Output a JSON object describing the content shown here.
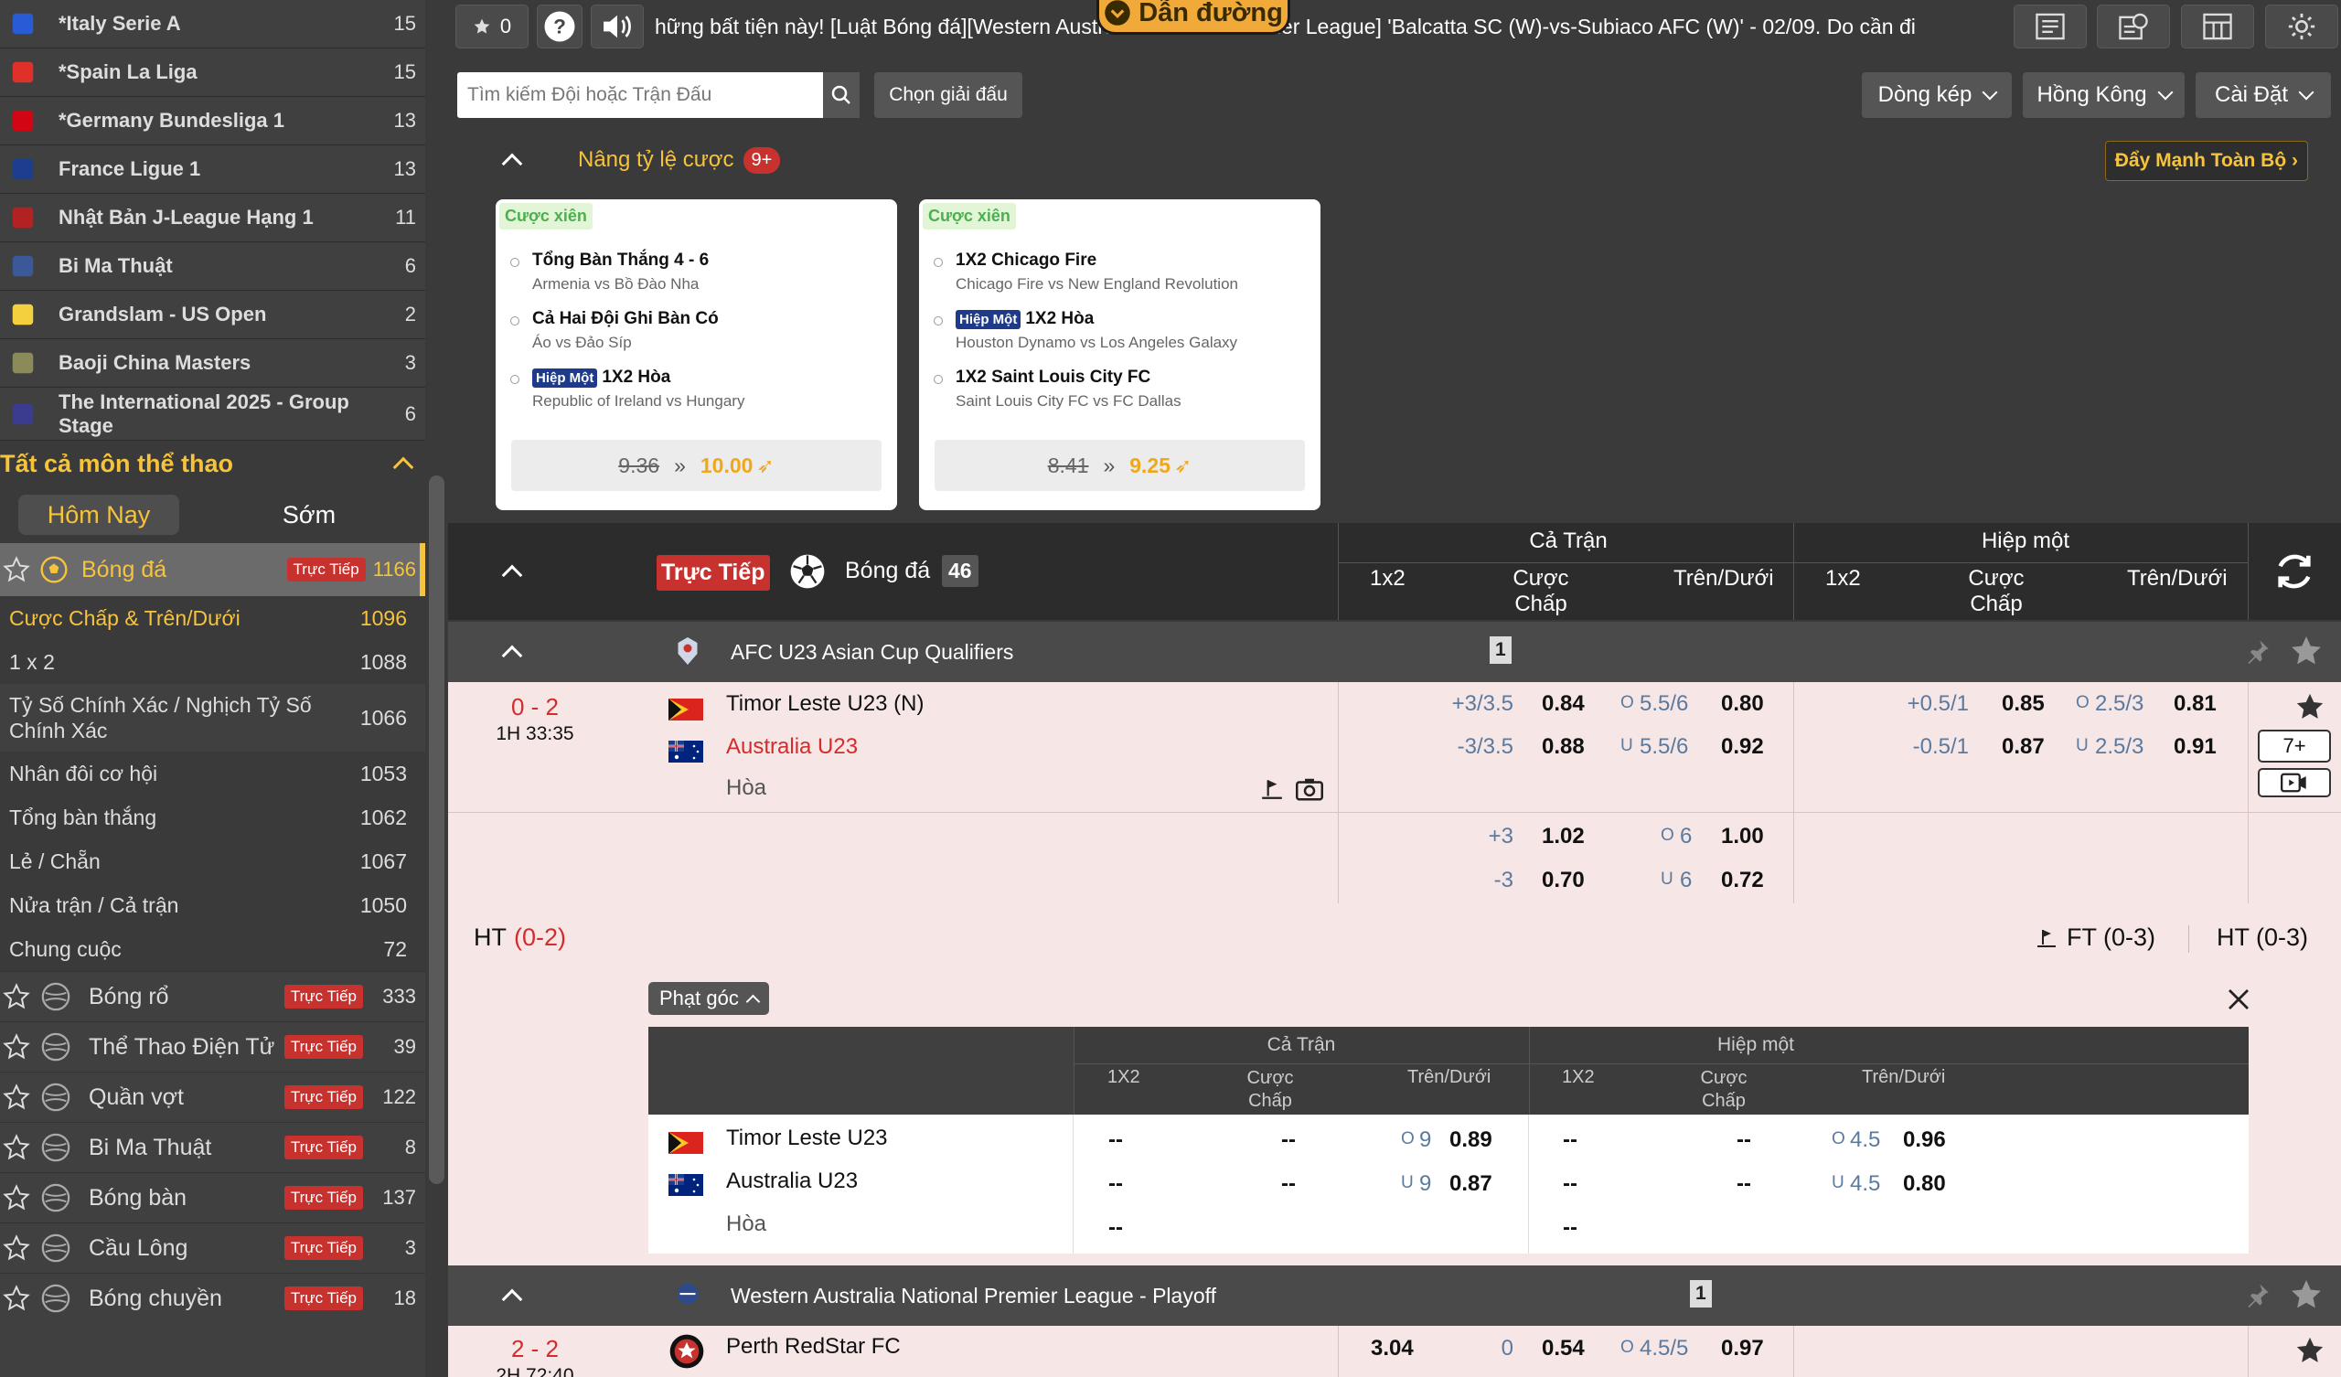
{
  "left_leagues": [
    {
      "name": "*Italy Serie A",
      "count": "15",
      "icon": "serie-a-icon",
      "color": "#2a5bd7"
    },
    {
      "name": "*Spain La Liga",
      "count": "15",
      "icon": "laliga-icon",
      "color": "#e0302a"
    },
    {
      "name": "*Germany Bundesliga 1",
      "count": "13",
      "icon": "bundesliga-icon",
      "color": "#d20515"
    },
    {
      "name": "France Ligue 1",
      "count": "13",
      "icon": "ligue1-icon",
      "color": "#1d3e8f"
    },
    {
      "name": "Nhật Bản J-League Hạng 1",
      "count": "11",
      "icon": "jleague-icon",
      "color": "#b22222"
    },
    {
      "name": "Bi Ma Thuật",
      "count": "6",
      "icon": "billiards-icon",
      "color": "#3b5998"
    },
    {
      "name": "Grandslam - US Open",
      "count": "2",
      "icon": "usopen-icon",
      "color": "#f4d03f"
    },
    {
      "name": "Baoji China Masters",
      "count": "3",
      "icon": "badminton-icon",
      "color": "#8b8b5a"
    },
    {
      "name": "The International 2025 - Group Stage",
      "count": "6",
      "icon": "dota-icon",
      "color": "#3b3b8f"
    }
  ],
  "all_sports_title": "Tất cả môn thể thao",
  "day_tabs": {
    "today": "Hôm Nay",
    "early": "Sớm"
  },
  "selected_sport": {
    "name": "Bóng đá",
    "live": "Trực Tiếp",
    "count": "1166"
  },
  "bet_types": [
    {
      "name": "Cược Chấp & Trên/Dưới",
      "count": "1096"
    },
    {
      "name": "1 x 2",
      "count": "1088"
    },
    {
      "name": "Tỷ Số Chính Xác / Nghịch Tỷ Số Chính Xác",
      "count": "1066"
    },
    {
      "name": "Nhân đôi cơ hội",
      "count": "1053"
    },
    {
      "name": "Tổng bàn thắng",
      "count": "1062"
    },
    {
      "name": "Lẻ / Chẵn",
      "count": "1067"
    },
    {
      "name": "Nửa trận / Cả trận",
      "count": "1050"
    },
    {
      "name": "Chung cuộc",
      "count": "72"
    }
  ],
  "other_sports": [
    {
      "name": "Bóng rổ",
      "live": "Trực Tiếp",
      "count": "333",
      "icon": "basketball-icon"
    },
    {
      "name": "Thể Thao Điện Tử",
      "live": "Trực Tiếp",
      "count": "39",
      "icon": "gamepad-icon"
    },
    {
      "name": "Quần vợt",
      "live": "Trực Tiếp",
      "count": "122",
      "icon": "tennis-icon"
    },
    {
      "name": "Bi Ma Thuật",
      "live": "Trực Tiếp",
      "count": "8",
      "icon": "billiards-cue-icon"
    },
    {
      "name": "Bóng bàn",
      "live": "Trực Tiếp",
      "count": "137",
      "icon": "pingpong-icon"
    },
    {
      "name": "Cầu Lông",
      "live": "Trực Tiếp",
      "count": "3",
      "icon": "shuttlecock-icon"
    },
    {
      "name": "Bóng chuyền",
      "live": "Trực Tiếp",
      "count": "18",
      "icon": "volleyball-icon"
    }
  ],
  "topbar": {
    "fav_count": "0",
    "ticker": "hững bất tiện này!    [Luật Bóng đá][Western Australia National Premier League] 'Balcatta SC (W)-vs-Subiaco AFC (W)' - 02/09. Do cần đi",
    "guide": "Dẫn đường"
  },
  "search": {
    "placeholder": "Tìm kiếm Đội hoặc Trận Đấu",
    "choose_league": "Chọn giải đấu"
  },
  "dropdowns": {
    "odds_view": "Dòng kép",
    "odds_type": "Hồng Kông",
    "settings": "Cài Đặt"
  },
  "boost": {
    "title": "Nâng tỷ lệ cược",
    "badge": "9+",
    "push_all": "Đẩy Mạnh Toàn Bộ ›"
  },
  "cards": [
    {
      "tag": "Cược xiên",
      "items": [
        {
          "title": "Tổng Bàn Thắng 4 - 6",
          "sub": "Armenia vs Bồ Đào Nha",
          "half": ""
        },
        {
          "title": "Cả Hai Đội Ghi Bàn Có",
          "sub": "Áo vs Đảo Síp",
          "half": ""
        },
        {
          "title": "1X2 Hòa",
          "sub": "Republic of Ireland vs Hungary",
          "half": "Hiệp Một"
        }
      ],
      "old": "9.36",
      "new": "10.00"
    },
    {
      "tag": "Cược xiên",
      "items": [
        {
          "title": "1X2 Chicago Fire",
          "sub": "Chicago Fire vs New England Revolution",
          "half": ""
        },
        {
          "title": "1X2 Hòa",
          "sub": "Houston Dynamo vs Los Angeles Galaxy",
          "half": "Hiệp Một"
        },
        {
          "title": "1X2 Saint Louis City FC",
          "sub": "Saint Louis City FC vs FC Dallas",
          "half": ""
        }
      ],
      "old": "8.41",
      "new": "9.25"
    }
  ],
  "header": {
    "live": "Trực Tiếp",
    "sport": "Bóng đá",
    "count": "46",
    "full": "Cả Trận",
    "half": "Hiệp một",
    "c1x2": "1x2",
    "hcp1": "Cược",
    "hcp2": "Chấp",
    "ou": "Trên/Dưới"
  },
  "league1": {
    "name": "AFC U23 Asian Cup Qualifiers",
    "count": "1"
  },
  "match1": {
    "score": "0 - 2",
    "time": "1H 33:35",
    "home": "Timor Leste U23  (N)",
    "away": "Australia U23",
    "draw": "Hòa",
    "ft_h_hcp": "+3/3.5",
    "ft_h_odd": "0.84",
    "ft_o_lbl": "O",
    "ft_o_line": "5.5/6",
    "ft_o_odd": "0.80",
    "ft_a_hcp": "-3/3.5",
    "ft_a_odd": "0.88",
    "ft_u_lbl": "U",
    "ft_u_line": "5.5/6",
    "ft_u_odd": "0.92",
    "h1_h_hcp": "+0.5/1",
    "h1_h_odd": "0.85",
    "h1_o_line": "2.5/3",
    "h1_o_odd": "0.81",
    "h1_a_hcp": "-0.5/1",
    "h1_a_odd": "0.87",
    "h1_u_line": "2.5/3",
    "h1_u_odd": "0.91",
    "more": "7+",
    "r2_h_hcp": "+3",
    "r2_h_odd": "1.02",
    "r2_o_line": "6",
    "r2_o_odd": "1.00",
    "r2_a_hcp": "-3",
    "r2_a_odd": "0.70",
    "r2_u_line": "6",
    "r2_u_odd": "0.72"
  },
  "result": {
    "ht_lbl": "HT",
    "ht_val": "(0-2)",
    "ft": "FT (0-3)",
    "ht2": "HT (0-3)"
  },
  "corners": {
    "label": "Phạt góc",
    "full": "Cả Trận",
    "half": "Hiệp một",
    "c1x2": "1X2",
    "hcp1": "Cược",
    "hcp2": "Chấp",
    "ou": "Trên/Dưới",
    "home": "Timor Leste U23",
    "away": "Australia U23",
    "draw": "Hòa",
    "dash": "--",
    "o_lbl": "O",
    "u_lbl": "U",
    "ft_o_line": "9",
    "ft_o_odd": "0.89",
    "ft_u_line": "9",
    "ft_u_odd": "0.87",
    "h1_o_line": "4.5",
    "h1_o_odd": "0.96",
    "h1_u_line": "4.5",
    "h1_u_odd": "0.80"
  },
  "league2": {
    "name": "Western Australia National Premier League - Playoff",
    "count": "1"
  },
  "match2": {
    "score": "2 - 2",
    "time": "2H 72:40",
    "home": "Perth RedStar FC",
    "x1": "3.04",
    "hcp": "0",
    "hodd": "0.54",
    "o_lbl": "O",
    "o_line": "4.5/5",
    "o_odd": "0.97"
  }
}
